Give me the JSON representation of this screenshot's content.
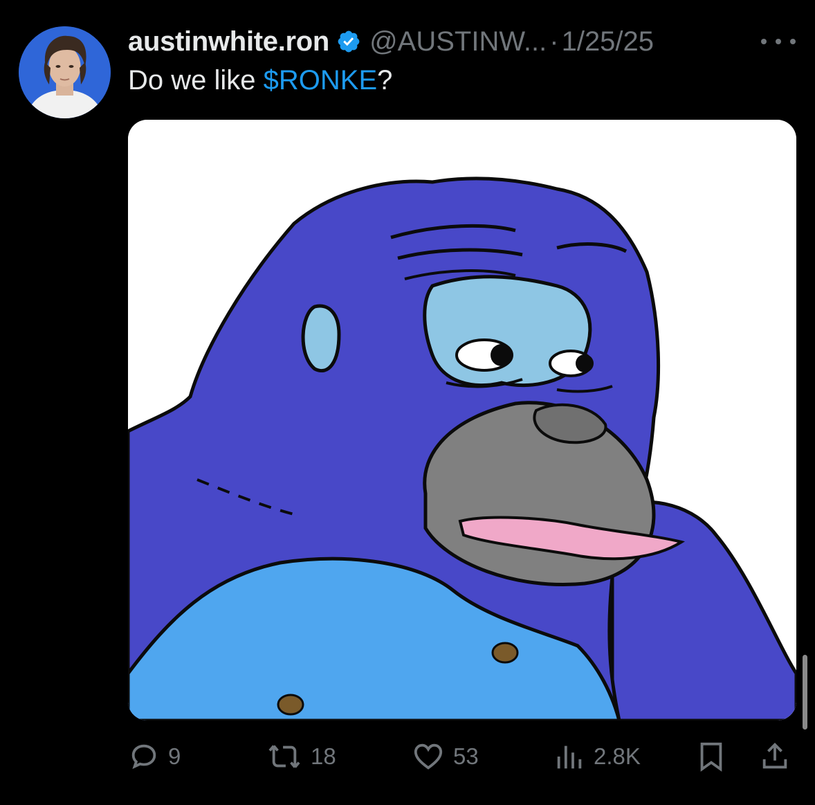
{
  "post": {
    "display_name": "austinwhite.ron",
    "handle": "@AUSTINW...",
    "separator": "·",
    "date": "1/25/25",
    "text_before": "Do we like ",
    "cashtag": "$RONKE",
    "text_after": "?"
  },
  "metrics": {
    "replies": "9",
    "reposts": "18",
    "likes": "53",
    "views": "2.8K"
  },
  "colors": {
    "background": "#000000",
    "primary_text": "#e7e9ea",
    "secondary_text": "#71767b",
    "link": "#1d9bf0",
    "verified_badge": "#1d9bf0"
  },
  "icons": {
    "verified": "verified-badge-icon",
    "more": "more-dots-icon",
    "reply": "reply-bubble-icon",
    "repost": "repost-arrows-icon",
    "like": "heart-icon",
    "views": "bar-chart-icon",
    "bookmark": "bookmark-icon",
    "share": "share-upload-icon"
  }
}
